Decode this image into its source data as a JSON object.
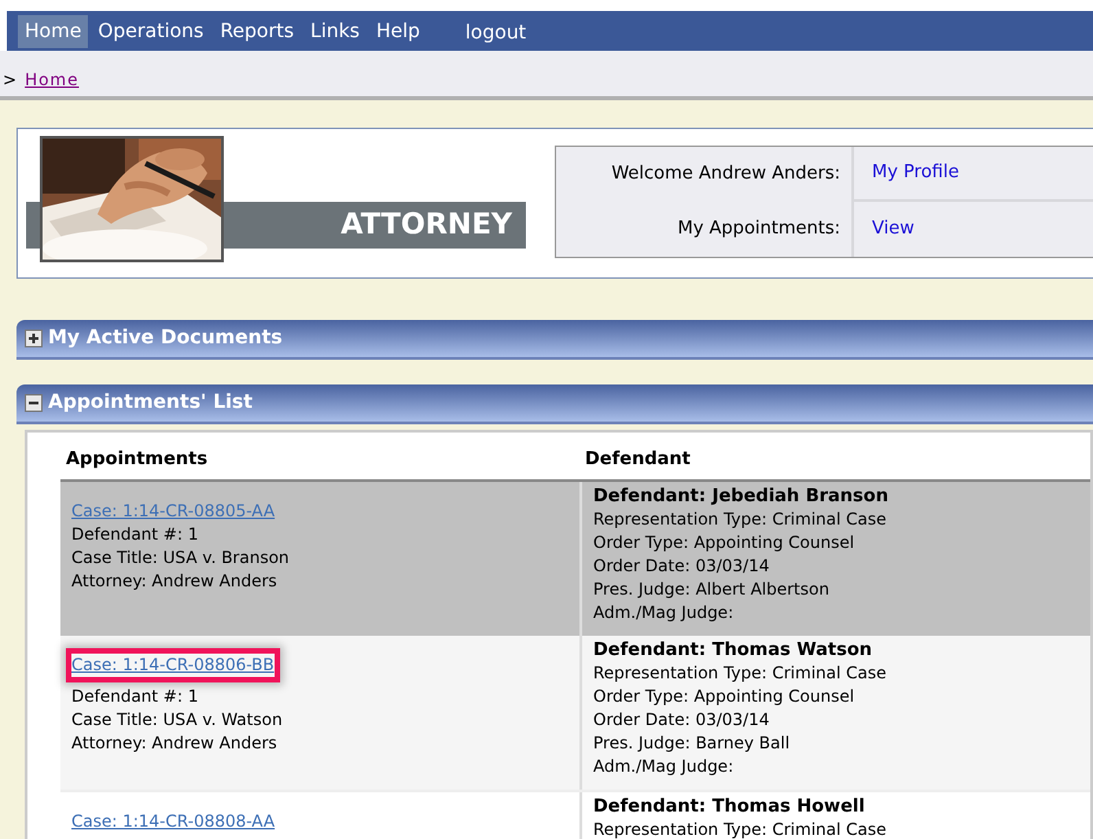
{
  "nav": {
    "items": [
      {
        "label": "Home",
        "selected": true
      },
      {
        "label": "Operations",
        "selected": false
      },
      {
        "label": "Reports",
        "selected": false
      },
      {
        "label": "Links",
        "selected": false
      },
      {
        "label": "Help",
        "selected": false
      }
    ],
    "logout": "logout"
  },
  "breadcrumb": {
    "prefix": ">",
    "link": "Home"
  },
  "header": {
    "role_title": "ATTORNEY",
    "info": [
      {
        "label": "Welcome Andrew Anders:",
        "link": "My Profile"
      },
      {
        "label": "My Appointments:",
        "link": "View"
      }
    ]
  },
  "panels": [
    {
      "title": "My Active Documents",
      "expanded": false
    },
    {
      "title": "Appointments' List",
      "expanded": true
    }
  ],
  "appointments": {
    "columns": [
      "Appointments",
      "Defendant"
    ],
    "rows": [
      {
        "selected": true,
        "annotated": false,
        "case": "Case: 1:14-CR-08805-AA",
        "lines": [
          "Defendant #: 1",
          "Case Title: USA v. Branson",
          "Attorney: Andrew Anders"
        ],
        "defendant": "Defendant: Jebediah Branson",
        "details": [
          "Representation Type: Criminal Case",
          "Order Type: Appointing Counsel",
          "Order Date: 03/03/14",
          "Pres. Judge: Albert Albertson",
          "Adm./Mag Judge:"
        ]
      },
      {
        "selected": false,
        "annotated": true,
        "case": "Case: 1:14-CR-08806-BB",
        "lines": [
          "Defendant #: 1",
          "Case Title: USA v. Watson",
          "Attorney: Andrew Anders"
        ],
        "defendant": "Defendant: Thomas Watson",
        "details": [
          "Representation Type: Criminal Case",
          "Order Type: Appointing Counsel",
          "Order Date: 03/03/14",
          "Pres. Judge: Barney Ball",
          "Adm./Mag Judge:"
        ]
      },
      {
        "selected": false,
        "annotated": false,
        "case": "Case: 1:14-CR-08808-AA",
        "defendant": "Defendant: Thomas Howell",
        "details": [
          "Representation Type: Criminal Case"
        ]
      }
    ]
  }
}
